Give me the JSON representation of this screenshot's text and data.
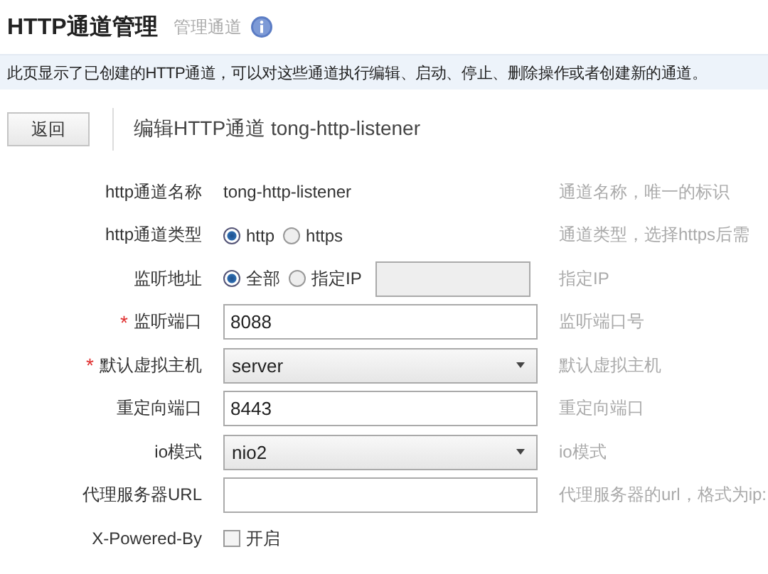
{
  "header": {
    "title": "HTTP通道管理",
    "subtitle": "管理通道"
  },
  "notice": "此页显示了已创建的HTTP通道，可以对这些通道执行编辑、启动、停止、删除操作或者创建新的通道。",
  "toolbar": {
    "back_button": "返回",
    "heading": "编辑HTTP通道 tong-http-listener"
  },
  "fields": [
    {
      "kind": "text",
      "label": "http通道名称",
      "value": "tong-http-listener",
      "hint": "通道名称，唯一的标识"
    },
    {
      "kind": "radio",
      "label": "http通道类型",
      "options": [
        {
          "label": "http",
          "selected": true
        },
        {
          "label": "https",
          "selected": false
        }
      ],
      "hint": "通道类型，选择https后需"
    },
    {
      "kind": "radio_input",
      "label": "监听地址",
      "options": [
        {
          "label": "全部",
          "selected": true
        },
        {
          "label": "指定IP",
          "selected": false
        }
      ],
      "disabled": true,
      "hint": "指定IP"
    },
    {
      "kind": "input",
      "label": "监听端口",
      "required_mark": "*",
      "value": "8088",
      "hint": "监听端口号"
    },
    {
      "kind": "select",
      "label": "默认虚拟主机",
      "required_mark": "*",
      "value": "server",
      "hint": "默认虚拟主机"
    },
    {
      "kind": "input",
      "label": "重定向端口",
      "value": "8443",
      "hint": "重定向端口"
    },
    {
      "kind": "select",
      "label": "io模式",
      "value": "nio2",
      "hint": "io模式"
    },
    {
      "kind": "input",
      "label": "代理服务器URL",
      "hint": "代理服务器的url，格式为ip:"
    },
    {
      "kind": "checkbox",
      "label": "X-Powered-By",
      "checked": false,
      "option": "开启"
    }
  ]
}
